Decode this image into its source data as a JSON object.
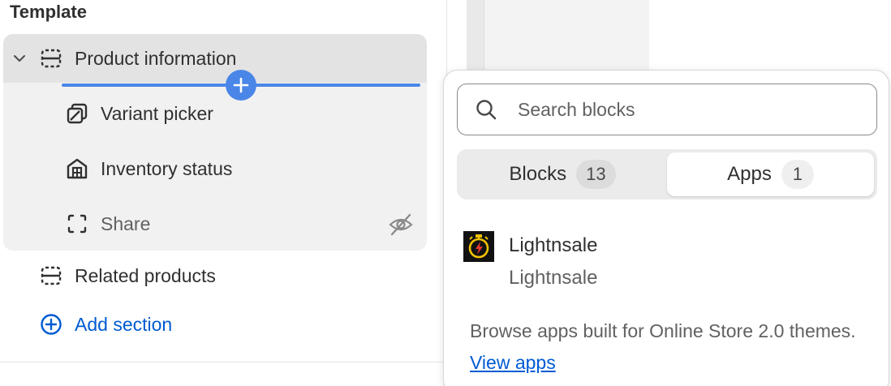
{
  "template_panel": {
    "title": "Template",
    "sections": [
      {
        "label": "Product information",
        "expanded": true,
        "blocks": [
          {
            "label": "Variant picker",
            "icon": "variant-picker-icon"
          },
          {
            "label": "Inventory status",
            "icon": "inventory-icon"
          },
          {
            "label": "Share",
            "icon": "share-dashed-icon",
            "hidden": true
          }
        ]
      },
      {
        "label": "Related products",
        "icon": "section-icon"
      }
    ],
    "add_section_label": "Add section"
  },
  "block_picker": {
    "search_placeholder": "Search blocks",
    "tabs": [
      {
        "label": "Blocks",
        "count": "13",
        "active": false
      },
      {
        "label": "Apps",
        "count": "1",
        "active": true
      }
    ],
    "apps": [
      {
        "name": "Lightnsale",
        "developer": "Lightnsale",
        "icon": "lightnsale-logo"
      }
    ],
    "browse_text": "Browse apps built for Online Store 2.0 themes.",
    "browse_link": "View apps"
  },
  "colors": {
    "accent": "#005bd3",
    "drop_indicator": "#4a86e8",
    "selected_bg": "#e3e3e3"
  }
}
